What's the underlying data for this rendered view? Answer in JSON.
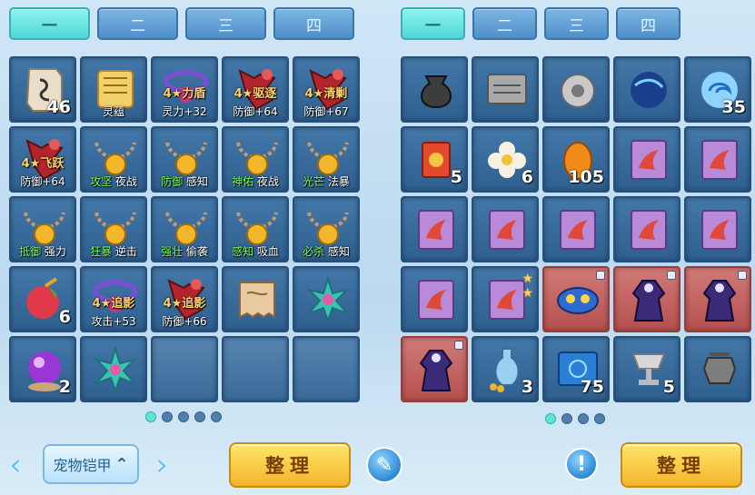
{
  "colors": {
    "accent_tab": "#5fe5d8",
    "slot": "#2e5f8f",
    "special_slot": "#b5504f",
    "button": "#f2b52a"
  },
  "left": {
    "tabs": [
      "一",
      "二",
      "三",
      "四"
    ],
    "slots": [
      {
        "icon": "scroll-icon",
        "count": "46"
      },
      {
        "icon": "spirit-scroll-icon",
        "caption": "灵蕴"
      },
      {
        "icon": "purple-amulet-icon",
        "overlay": "4★力盾",
        "caption": "灵力+32"
      },
      {
        "icon": "red-armor-icon",
        "overlay": "4★驱逐",
        "caption": "防御+64"
      },
      {
        "icon": "red-armor-icon",
        "overlay": "4★清剿",
        "caption": "防御+67"
      },
      {
        "icon": "red-armor-icon",
        "overlay": "4★飞跃",
        "caption": "防御+64"
      },
      {
        "icon": "gold-necklace-icon",
        "tag": "攻坚",
        "caption": "夜战"
      },
      {
        "icon": "gold-necklace-icon",
        "tag": "防御",
        "caption": "感知"
      },
      {
        "icon": "gold-necklace-icon",
        "tag": "神佑",
        "caption": "夜战"
      },
      {
        "icon": "gold-necklace-icon",
        "tag": "光芒",
        "caption": "法暴"
      },
      {
        "icon": "gold-necklace-icon",
        "tag": "抵御",
        "caption": "强力"
      },
      {
        "icon": "gold-necklace-icon",
        "tag": "狂暴",
        "caption": "逆击"
      },
      {
        "icon": "gold-necklace-icon",
        "tag": "强壮",
        "caption": "偷袭"
      },
      {
        "icon": "gold-necklace-icon",
        "tag": "感知",
        "caption": "吸血"
      },
      {
        "icon": "gold-necklace-icon",
        "tag": "必杀",
        "caption": "感知"
      },
      {
        "icon": "red-fruit-icon",
        "count": "6"
      },
      {
        "icon": "purple-amulet-icon",
        "overlay": "4★追影",
        "caption": "攻击+53"
      },
      {
        "icon": "red-armor-icon",
        "overlay": "4★追影",
        "caption": "防御+66"
      },
      {
        "icon": "parchment-icon"
      },
      {
        "icon": "crystal-flower-icon"
      },
      {
        "icon": "purple-orb-icon",
        "count": "2"
      },
      {
        "icon": "crystal-flower-icon"
      },
      {
        "icon": "empty"
      },
      {
        "icon": "empty"
      },
      {
        "icon": "empty"
      }
    ],
    "page_dots": 5,
    "active_dot": 0,
    "dropdown_label": "宠物铠甲",
    "sort_label": "整理"
  },
  "right": {
    "tabs": [
      "一",
      "二",
      "三",
      "四"
    ],
    "slots": [
      {
        "icon": "pouch-icon"
      },
      {
        "icon": "silver-tablet-icon"
      },
      {
        "icon": "silver-bell-icon"
      },
      {
        "icon": "blue-orb-icon"
      },
      {
        "icon": "swirl-orb-icon",
        "count": "35"
      },
      {
        "icon": "red-flower-card-icon",
        "count": "5"
      },
      {
        "icon": "white-flower-icon",
        "count": "6"
      },
      {
        "icon": "orange-egg-icon",
        "count": "105"
      },
      {
        "icon": "dragon-scroll-icon"
      },
      {
        "icon": "dragon-scroll-icon"
      },
      {
        "icon": "dragon-scroll-icon"
      },
      {
        "icon": "dragon-scroll-icon"
      },
      {
        "icon": "dragon-scroll-icon"
      },
      {
        "icon": "dragon-scroll-icon"
      },
      {
        "icon": "dragon-scroll-icon"
      },
      {
        "icon": "dragon-scroll-icon"
      },
      {
        "icon": "dragon-scroll-icon",
        "stars": 2
      },
      {
        "icon": "mask-icon",
        "special": true,
        "lock": true
      },
      {
        "icon": "robe-icon",
        "special": true,
        "lock": true
      },
      {
        "icon": "robe-icon",
        "special": true,
        "lock": true
      },
      {
        "icon": "robe-icon",
        "special": true,
        "lock": true
      },
      {
        "icon": "vase-coins-icon",
        "count": "3"
      },
      {
        "icon": "blue-book-icon",
        "count": "75"
      },
      {
        "icon": "silver-chalice-icon",
        "count": "5"
      },
      {
        "icon": "silver-urn-icon"
      }
    ],
    "page_dots": 4,
    "active_dot": 0,
    "sort_label": "整理"
  }
}
